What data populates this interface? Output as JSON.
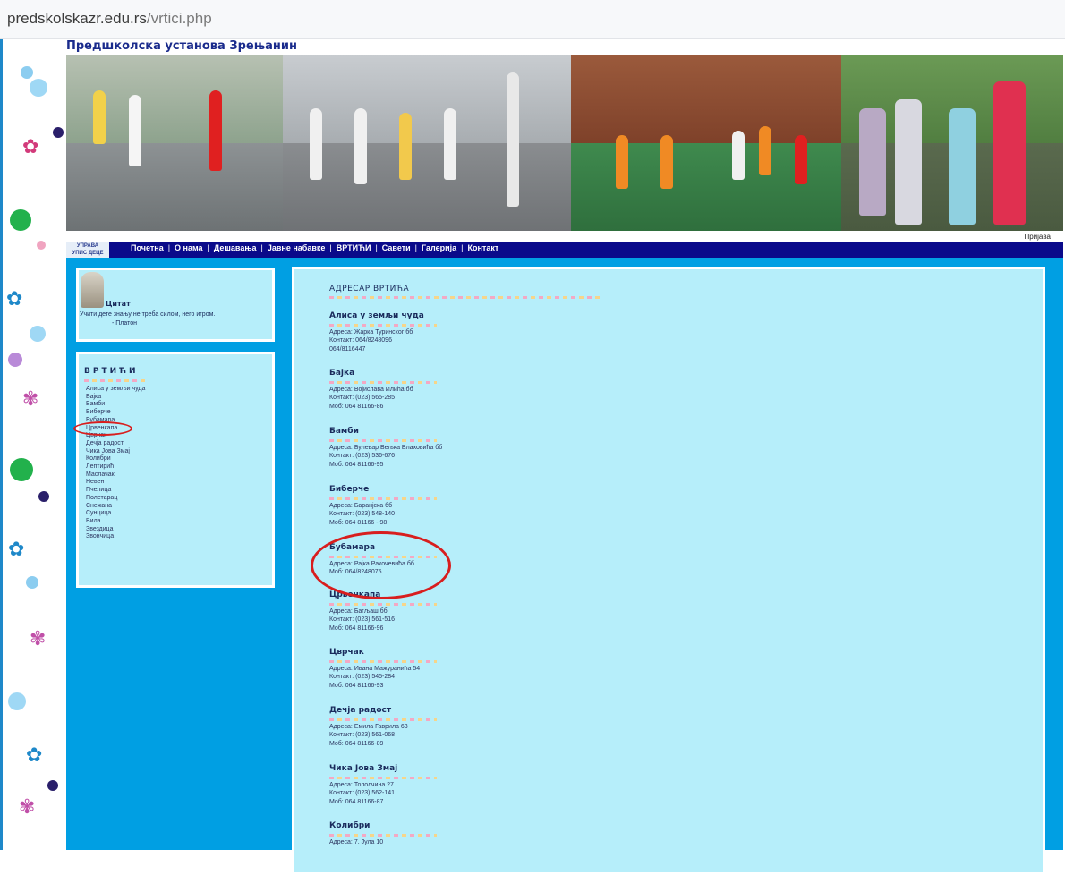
{
  "browser": {
    "url_host": "predskolskazr.edu.rs",
    "url_path": "/vrtici.php"
  },
  "site": {
    "title": "Предшколска установа Зрењанин",
    "login": "Пријава"
  },
  "nav": {
    "badge_top": "УПРАВА",
    "badge_bottom": "УПИС ДЕЦЕ",
    "items": [
      "Почетна",
      "О нама",
      "Дешавања",
      "Јавне набавке",
      "ВРТИЋИ",
      "Савети",
      "Галерија",
      "Контакт"
    ]
  },
  "quote": {
    "title": "Цитат",
    "text": "Учити дете знању не треба силом, него игром.",
    "author": "- Платон"
  },
  "kindergartens": {
    "title": "ВРТИЋИ",
    "items": [
      "Алиса у земљи чуда",
      "Бајка",
      "Бамби",
      "Биберче",
      "Бубамара",
      "Црвенкапа",
      "Цврчак",
      "Дечја радост",
      "Чика Јова Змај",
      "Колибри",
      "Лептирић",
      "Маслачак",
      "Невен",
      "Пчелица",
      "Полетарац",
      "Снежана",
      "Сунцица",
      "Вила",
      "Звездица",
      "Звончица"
    ]
  },
  "directory": {
    "title": "АДРЕСАР ВРТИЋА",
    "entries": [
      {
        "name": "Алиса у земљи чуда",
        "lines": [
          "Адреса: Жарка Туринског бб",
          "Контакт: 064/8248096",
          "064/8116447"
        ]
      },
      {
        "name": "Бајка",
        "lines": [
          "Адреса: Војислава Илића бб",
          "Контакт: (023) 565-285",
          "Моб: 064 81166-86"
        ]
      },
      {
        "name": "Бамби",
        "lines": [
          "Адреса: Булевар Вељка Влаховића бб",
          "Контакт: (023) 536-676",
          "Моб: 064 81166-95"
        ]
      },
      {
        "name": "Биберче",
        "lines": [
          "Адреса: Баранjска бб",
          "Контакт: (023) 548-140",
          "Моб: 064 81166 - 98"
        ]
      },
      {
        "name": "Бубамара",
        "lines": [
          "Адреса: Рајка Ракочевића бб",
          "Моб: 064/8248075"
        ]
      },
      {
        "name": "Црвенкапа",
        "lines": [
          "Адреса: Багљаш бб",
          "Контакт: (023) 561-516",
          "Моб: 064 81166-96"
        ]
      },
      {
        "name": "Цврчак",
        "lines": [
          "Адреса: Ивана Мажуранића 54",
          "Контакт: (023) 545-284",
          "Моб: 064 81166-93"
        ]
      },
      {
        "name": "Дечја радост",
        "lines": [
          "Адреса: Емила Гаврила 63",
          "Контакт: (023) 561-068",
          "Моб: 064 81166-89"
        ]
      },
      {
        "name": "Чика Јова Змај",
        "lines": [
          "Адреса: Тополчина 27",
          "Контакт: (023) 562-141",
          "Моб: 064 81166-87"
        ]
      },
      {
        "name": "Колибри",
        "lines": [
          "Адреса: 7. Јула 10"
        ]
      }
    ]
  },
  "colors": {
    "nav": "#0a0a8a",
    "main_bg": "#009fe3",
    "box_bg": "#b6eefa",
    "annotation": "#d81e1e",
    "title": "#1a2b8c"
  }
}
